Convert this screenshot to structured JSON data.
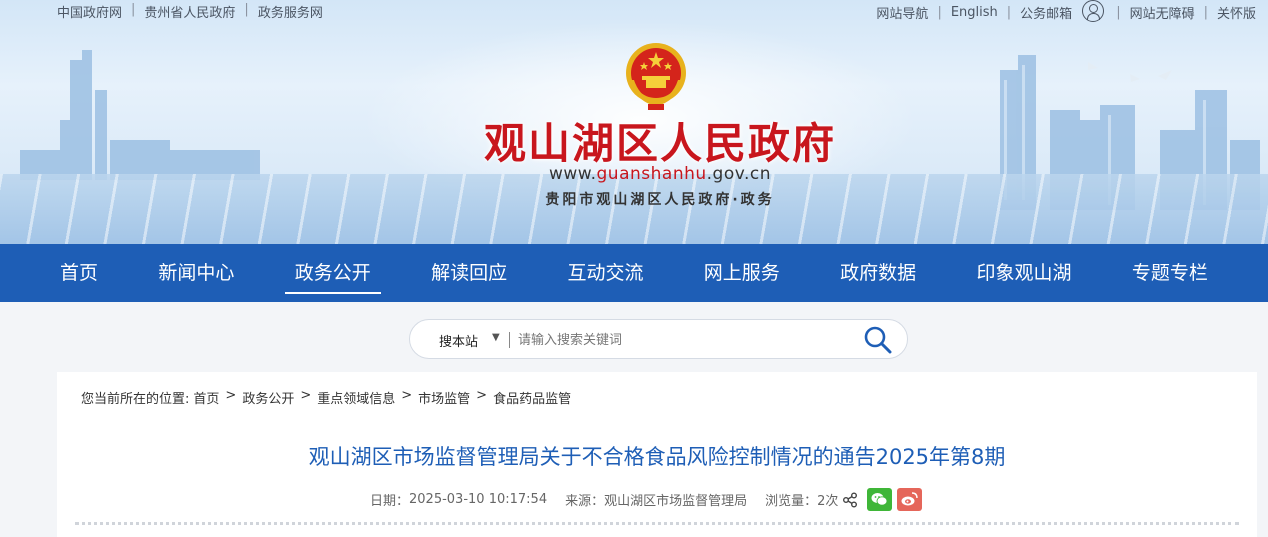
{
  "topbar": {
    "left_links": [
      "中国政府网",
      "贵州省人民政府",
      "政务服务网"
    ],
    "right_links": {
      "site_nav": "网站导航",
      "english": "English",
      "email": "公务邮箱",
      "accessibility": "网站无障碍",
      "elderly": "关怀版"
    }
  },
  "header": {
    "title": "观山湖区人民政府",
    "url_prefix": "www.",
    "url_highlight": "guanshanhu",
    "url_suffix": ".gov.cn",
    "subtitle": "贵阳市观山湖区人民政府·政务"
  },
  "nav": {
    "items": [
      {
        "label": "首页",
        "active": false
      },
      {
        "label": "新闻中心",
        "active": false
      },
      {
        "label": "政务公开",
        "active": true
      },
      {
        "label": "解读回应",
        "active": false
      },
      {
        "label": "互动交流",
        "active": false
      },
      {
        "label": "网上服务",
        "active": false
      },
      {
        "label": "政府数据",
        "active": false
      },
      {
        "label": "印象观山湖",
        "active": false
      },
      {
        "label": "专题专栏",
        "active": false
      }
    ]
  },
  "search": {
    "scope": "搜本站",
    "placeholder": "请输入搜索关键词",
    "value": ""
  },
  "breadcrumb": {
    "prefix": "您当前所在的位置:",
    "items": [
      "首页",
      "政务公开",
      "重点领域信息",
      "市场监管",
      "食品药品监管"
    ]
  },
  "article": {
    "title": "观山湖区市场监督管理局关于不合格食品风险控制情况的通告2025年第8期",
    "date_label": "日期：",
    "date": "2025-03-10 10:17:54",
    "source_label": "来源：",
    "source": "观山湖区市场监督管理局",
    "views_label": "浏览量：",
    "views": "2次"
  },
  "colors": {
    "nav_bg": "#1e5eb6",
    "title_red": "#c8161d",
    "article_title": "#1e5eb6"
  }
}
